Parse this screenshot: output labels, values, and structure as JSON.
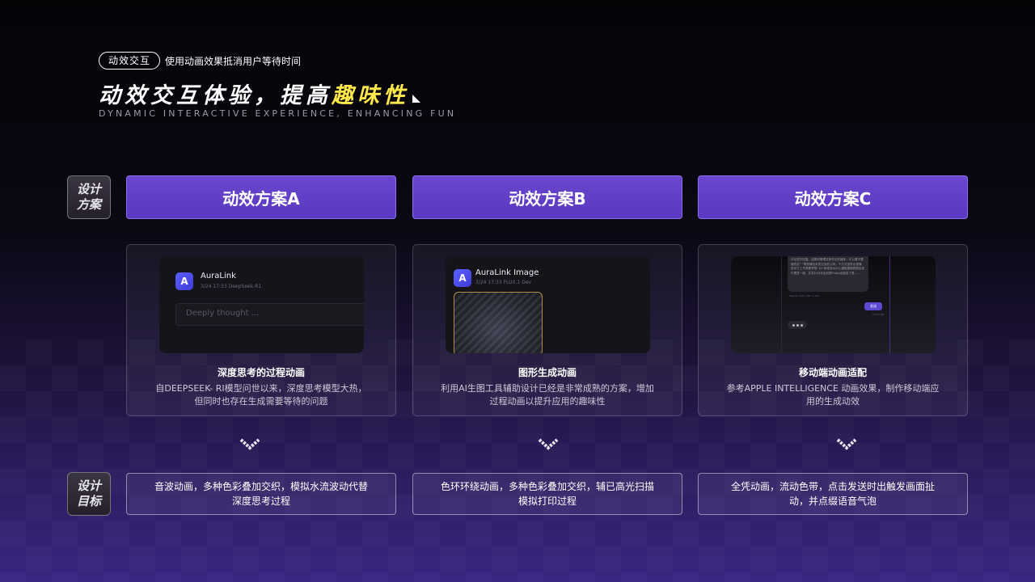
{
  "header": {
    "tag": "动效交互",
    "tag_desc": "使用动画效果抵消用户等待时间",
    "headline_main": "动效交互体验，提高",
    "headline_highlight": "趣味性",
    "subtitle": "DYNAMIC INTERACTIVE EXPERIENCE, ENHANCING FUN"
  },
  "side_labels": {
    "design_plan": [
      "设计",
      "方案"
    ],
    "design_goal": [
      "设计",
      "目标"
    ]
  },
  "plans": [
    {
      "label": "动效方案A",
      "preview": {
        "app_name": "AuraLink",
        "meta": "3/24 17:33    DeepSeek-R1",
        "placeholder": "Deeply thought ..."
      },
      "card_title": "深度思考的过程动画",
      "card_desc": "自DEEPSEEK- RI模型问世以来，深度思考模型大热，但同时也存在生成需要等待的问题",
      "goal": "音波动画，多种色彩叠加交织，模拟水流波动代替深度思考过程"
    },
    {
      "label": "动效方案B",
      "preview": {
        "app_name": "AuraLink Image",
        "meta": "3/24 17:33    FLUX.1 Dev"
      },
      "card_title": "图形生成动画",
      "card_desc": "利用AI生图工具辅助设计已经是非常成熟的方案，增加过程动画以提升应用的趣味性",
      "goal": "色环环绕动画，多种色彩叠加交织，辅已高光扫描模拟打印过程"
    },
    {
      "label": "动效方案C",
      "preview": {
        "chat_text": "评论进行回复。如果你管理这条评论的媒体，可以看不要做改变“ ”等表情包未表达你的公司，千万方选符合表情，快乐打工不再看梦想! 02 新增流水中心通知跟随表情出现行看显一面，并并针对评论用表Photo还增加了表……",
        "chat_tiny": "Tokens: 230 | TTB: 1.32S",
        "send_label": "发送",
        "send_time": "12:34 PM"
      },
      "card_title": "移动端动画适配",
      "card_desc": "参考APPLE INTELLIGENCE 动画效果，制作移动端应用的生成动效",
      "goal": "全凭动画，流动色带，点击发送时出触发画面扯动，并点缀语音气泡"
    }
  ],
  "icons": {
    "app": "A",
    "arrow": "chevron-down-icon"
  },
  "colors": {
    "accent": "#5f3dc7",
    "highlight": "#ffe94a"
  }
}
